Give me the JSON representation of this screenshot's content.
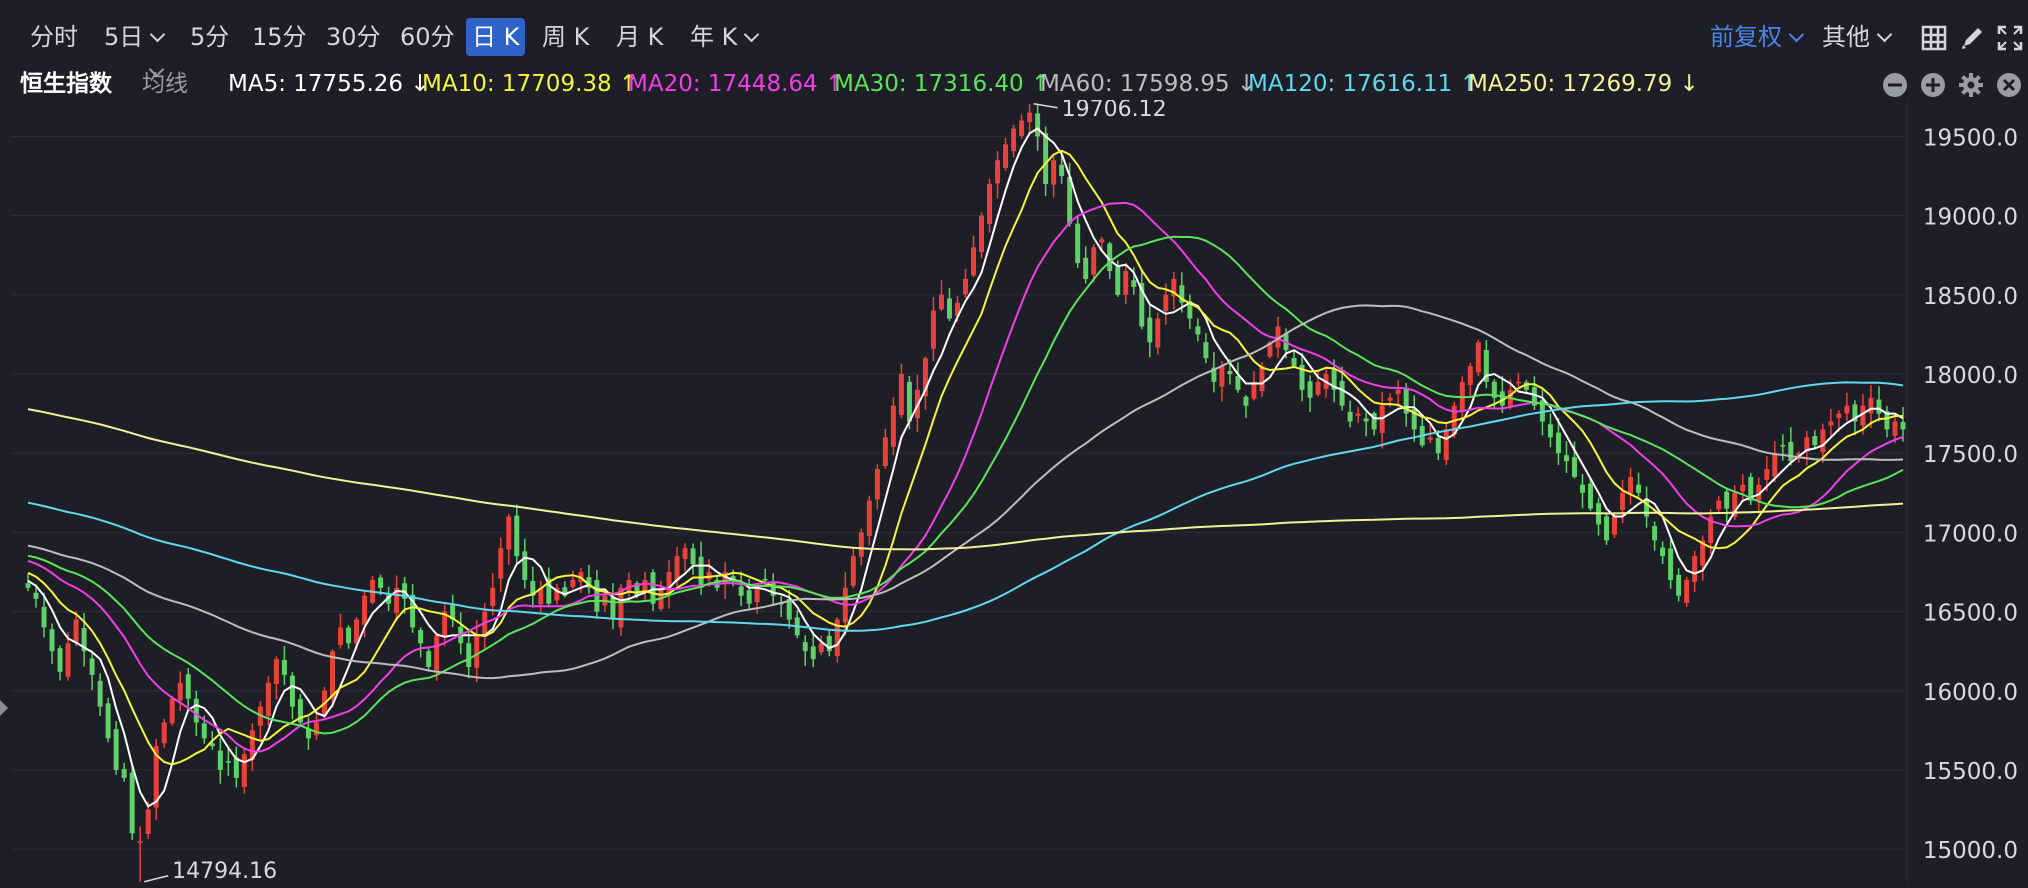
{
  "toolbar": {
    "timeframes": [
      {
        "label": "分时",
        "dropdown": false,
        "active": false
      },
      {
        "label": "5日",
        "dropdown": true,
        "active": false
      },
      {
        "label": "5分",
        "dropdown": false,
        "active": false
      },
      {
        "label": "15分",
        "dropdown": false,
        "active": false
      },
      {
        "label": "30分",
        "dropdown": false,
        "active": false
      },
      {
        "label": "60分",
        "dropdown": false,
        "active": false
      },
      {
        "label": "日 K",
        "dropdown": false,
        "active": true
      },
      {
        "label": "周 K",
        "dropdown": false,
        "active": false
      },
      {
        "label": "月 K",
        "dropdown": false,
        "active": false
      },
      {
        "label": "年 K",
        "dropdown": true,
        "active": false
      }
    ],
    "adjust_label": "前复权",
    "other_label": "其他",
    "icons": [
      "layout-grid-icon",
      "pen-icon",
      "fullscreen-icon"
    ]
  },
  "ma_bar": {
    "index_name": "恒生指数",
    "ma_select": "均线",
    "items": [
      {
        "label": "MA5: 17755.26 ↓",
        "color": "#ffffff"
      },
      {
        "label": "MA10: 17709.38 ↑",
        "color": "#f5f53d"
      },
      {
        "label": "MA20: 17448.64 ↑",
        "color": "#f03ee8"
      },
      {
        "label": "MA30: 17316.40 ↑",
        "color": "#5be35b"
      },
      {
        "label": "MA60: 17598.95 ↓",
        "color": "#bdbdbd"
      },
      {
        "label": "MA120: 17616.11 ↑",
        "color": "#5fd8f0"
      },
      {
        "label": "MA250: 17269.79 ↓",
        "color": "#f2f29a"
      }
    ],
    "controls": [
      "zoom-out-icon",
      "zoom-in-icon",
      "settings-icon",
      "close-icon"
    ]
  },
  "colors": {
    "up": "#e8433a",
    "down": "#5fd06a",
    "background": "#1e1f26",
    "grid": "#2c2e36",
    "axis_text": "#d8dadf"
  },
  "chart_data": {
    "type": "candlestick",
    "y_ticks": [
      15000,
      15500,
      16000,
      16500,
      17000,
      17500,
      18000,
      18500,
      19000,
      19500
    ],
    "y_tick_labels": [
      "15000.0",
      "15500.0",
      "16000.0",
      "16500.0",
      "17000.0",
      "17500.0",
      "18000.0",
      "18500.0",
      "19000.0",
      "19500.0"
    ],
    "ylim": [
      14780,
      19730
    ],
    "annotations": [
      {
        "text": "19706.12",
        "type": "high",
        "value": 19706.12
      },
      {
        "text": "14794.16",
        "type": "low",
        "value": 14794.16
      }
    ],
    "close": [
      16650,
      16580,
      16400,
      16250,
      16120,
      16300,
      16450,
      16250,
      16100,
      15900,
      15700,
      15500,
      15450,
      15100,
      15050,
      15250,
      15650,
      15800,
      15950,
      16050,
      15950,
      15800,
      15700,
      15650,
      15500,
      15550,
      15450,
      15600,
      15750,
      15900,
      16050,
      16200,
      16100,
      15900,
      15800,
      15700,
      15800,
      16000,
      16250,
      16400,
      16300,
      16450,
      16600,
      16700,
      16650,
      16550,
      16650,
      16580,
      16400,
      16300,
      16150,
      16350,
      16500,
      16450,
      16300,
      16150,
      16350,
      16500,
      16650,
      16900,
      17100,
      16850,
      16700,
      16600,
      16650,
      16550,
      16650,
      16600,
      16700,
      16750,
      16650,
      16500,
      16600,
      16450,
      16650,
      16700,
      16600,
      16700,
      16550,
      16650,
      16750,
      16850,
      16900,
      16800,
      16650,
      16750,
      16650,
      16750,
      16700,
      16600,
      16550,
      16650,
      16700,
      16600,
      16550,
      16450,
      16350,
      16250,
      16200,
      16300,
      16250,
      16450,
      16650,
      16850,
      17000,
      17200,
      17400,
      17600,
      17800,
      18000,
      17700,
      17900,
      18100,
      18400,
      18500,
      18350,
      18450,
      18600,
      18800,
      19000,
      19200,
      19350,
      19450,
      19550,
      19600,
      19650,
      19500,
      19200,
      19350,
      19250,
      18950,
      18700,
      18600,
      18800,
      18850,
      18650,
      18500,
      18650,
      18550,
      18300,
      18200,
      18350,
      18500,
      18600,
      18450,
      18350,
      18250,
      18100,
      17950,
      18050,
      18000,
      17900,
      17800,
      17950,
      18050,
      18200,
      18300,
      18150,
      18050,
      17900,
      17850,
      17950,
      18000,
      17900,
      17800,
      17700,
      17750,
      17700,
      17650,
      17800,
      17850,
      17900,
      17750,
      17650,
      17550,
      17600,
      17500,
      17650,
      17800,
      17950,
      18050,
      18200,
      17950,
      17850,
      17800,
      17900,
      17950,
      17900,
      17800,
      17700,
      17600,
      17500,
      17450,
      17350,
      17250,
      17150,
      17050,
      16950,
      17100,
      17250,
      17350,
      17250,
      17100,
      16950,
      16850,
      16700,
      16600,
      16700,
      16850,
      16950,
      17100,
      17200,
      17150,
      17250,
      17300,
      17200,
      17300,
      17400,
      17500,
      17550,
      17450,
      17500,
      17600,
      17550,
      17650,
      17700,
      17750,
      17800,
      17700,
      17800,
      17850,
      17750,
      17650,
      17700,
      17650
    ]
  }
}
